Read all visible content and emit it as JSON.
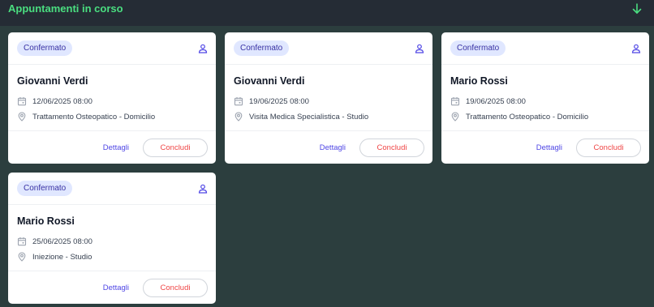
{
  "section": {
    "title": "Appuntamenti in corso"
  },
  "colors": {
    "accent": "#4ade80",
    "badge_bg": "#e0e7ff",
    "link": "#4f46e5",
    "danger": "#ef4444"
  },
  "cards": [
    {
      "status": "Confermato",
      "name": "Giovanni Verdi",
      "date": "12/06/2025 08:00",
      "place": "Trattamento Osteopatico - Domicilio",
      "details_label": "Dettagli",
      "conclude_label": "Concludi"
    },
    {
      "status": "Confermato",
      "name": "Giovanni Verdi",
      "date": "19/06/2025 08:00",
      "place": "Visita Medica Specialistica - Studio",
      "details_label": "Dettagli",
      "conclude_label": "Concludi"
    },
    {
      "status": "Confermato",
      "name": "Mario Rossi",
      "date": "19/06/2025 08:00",
      "place": "Trattamento Osteopatico - Domicilio",
      "details_label": "Dettagli",
      "conclude_label": "Concludi"
    },
    {
      "status": "Confermato",
      "name": "Mario Rossi",
      "date": "25/06/2025 08:00",
      "place": "Iniezione - Studio",
      "details_label": "Dettagli",
      "conclude_label": "Concludi"
    }
  ],
  "icons": {
    "collapse": "arrow-down-icon",
    "person": "person-icon",
    "calendar": "calendar-icon",
    "location": "location-pin-icon"
  }
}
